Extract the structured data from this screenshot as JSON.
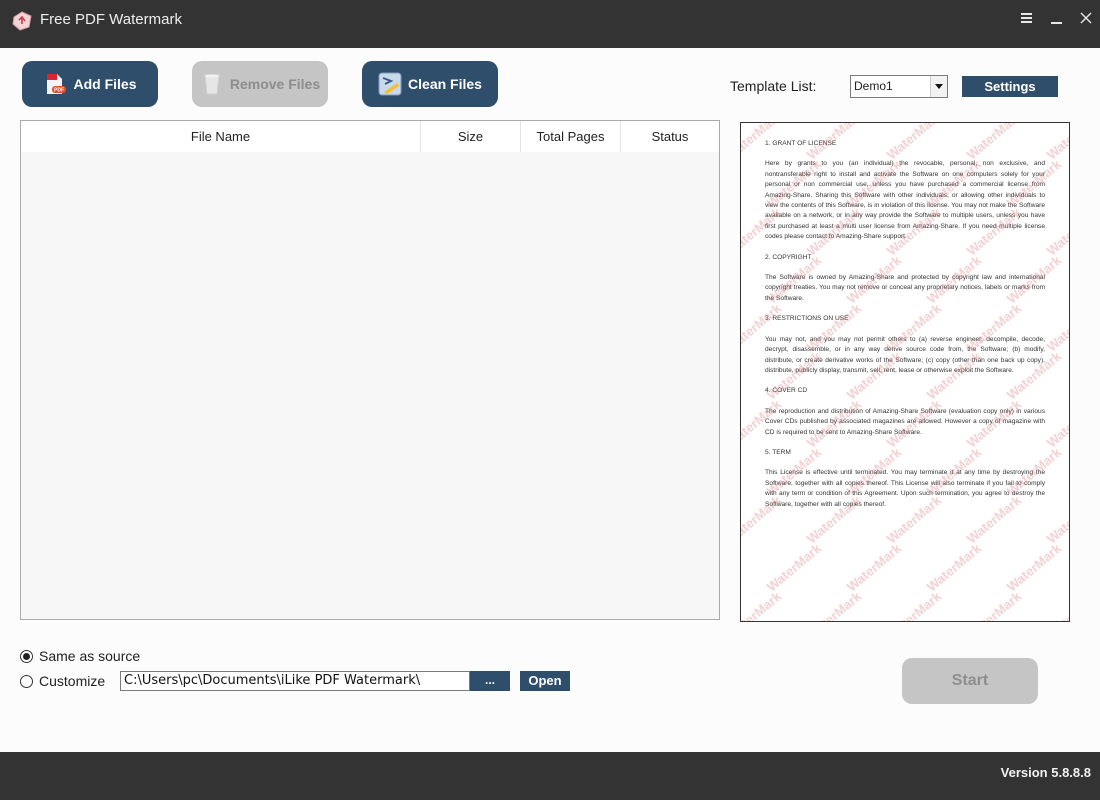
{
  "window": {
    "title": "Free PDF Watermark",
    "controls": [
      "menu-icon",
      "minimize-icon",
      "close-icon"
    ]
  },
  "toolbar": {
    "add_files": {
      "label": "Add Files",
      "icon": "pdf-file-icon",
      "enabled": true
    },
    "remove_files": {
      "label": "Remove Files",
      "icon": "trash-can-icon",
      "enabled": false
    },
    "clean_files": {
      "label": "Clean Files",
      "icon": "broom-icon",
      "enabled": true
    },
    "template_label": "Template List:",
    "template_selected": "Demo1",
    "settings_label": "Settings"
  },
  "file_table": {
    "columns": [
      "File Name",
      "Size",
      "Total Pages",
      "Status"
    ],
    "rows": []
  },
  "preview": {
    "watermark_text": "WaterMark",
    "sections": [
      {
        "heading": "1. GRANT OF LICENSE",
        "body": "Here by grants to you (an individual) the revocable, personal, non exclusive, and nontransferable right to install and activate the Software on one computers solely for your personal or non commercial use, unless you have purchased a commercial license from Amazing-Share. Sharing this Software with other individuals, or allowing other individuals to view the contents of this Software, is in violation of this license. You may not make the Software available on a network, or in any way provide the Software to multiple users, unless you have first purchased at least a multi user license from Amazing-Share. If you need multiple license codes please contact to Amazing-Share support."
      },
      {
        "heading": "2. COPYRIGHT",
        "body": "The Software is owned by Amazing-Share and protected by copyright law and international copyright treaties. You may not remove or conceal any proprietary notices, labels or marks from the Software."
      },
      {
        "heading": "3. RESTRICTIONS ON USE",
        "body": "You may not, and you may not permit others to (a) reverse engineer, decompile, decode, decrypt, disassemble, or in any way derive source code from, the Software; (b) modify, distribute, or create derivative works of the Software; (c) copy (other than one back up copy), distribute, publicly display, transmit, sell, rent, lease or otherwise exploit the Software."
      },
      {
        "heading": "4. COVER CD",
        "body": "The reproduction and distribution of Amazing-Share Software (evaluation copy only) in various Cover CDs published by associated magazines are allowed. However a copy of magazine with CD is required to be sent to Amazing-Share Software."
      },
      {
        "heading": "5. TERM",
        "body": "This License is effective until terminated. You may terminate it at any time by destroying the Software, together with all copies thereof. This License will also terminate if you fail to comply with any term or condition of this Agreement. Upon such termination, you agree to destroy the Software, together with all copies thereof."
      }
    ]
  },
  "output": {
    "same_as_source_label": "Same as source",
    "same_as_source_checked": true,
    "customize_label": "Customize",
    "customize_checked": false,
    "path_value": "C:\\Users\\pc\\Documents\\iLike PDF Watermark\\",
    "browse_label": "...",
    "open_label": "Open"
  },
  "start": {
    "label": "Start",
    "enabled": false
  },
  "footer": {
    "version": "Version 5.8.8.8"
  },
  "colors": {
    "titlebar": "#333333",
    "accent": "#2f4e6c",
    "disabled": "#c5c5c5",
    "watermark": "#dc7882"
  }
}
